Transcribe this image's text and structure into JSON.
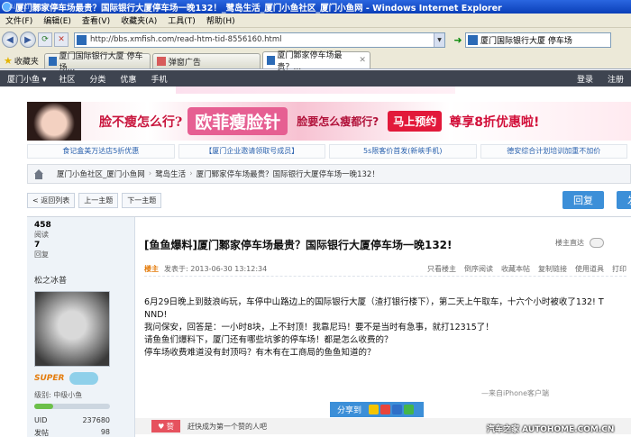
{
  "window": {
    "title": "厦门鄹家停车场最贵？国际银行大厦停车场一晚132！_鹭岛生活_厦门小鱼社区_厦门小鱼网 - Windows Internet Explorer",
    "watermark_overlay": "Ainkthutoe.com"
  },
  "menu": {
    "items": [
      "文件(F)",
      "编辑(E)",
      "查看(V)",
      "收藏夹(A)",
      "工具(T)",
      "帮助(H)"
    ]
  },
  "address": {
    "url": "http://bbs.xmfish.com/read-htm-tid-8556160.html",
    "search_value": "厦门国际银行大厦 停车场"
  },
  "favorites": {
    "label": "收藏夹",
    "tabs": [
      {
        "label": "厦门国际银行大厦 停车场..."
      },
      {
        "label": "弹窗广告"
      },
      {
        "label": "厦门鄹家停车场最贵？..."
      }
    ]
  },
  "sitenav": {
    "brand": "厦门小鱼 ▾",
    "items": [
      "社区",
      "分类",
      "优惠",
      "手机"
    ],
    "right": [
      "登录",
      "注册"
    ]
  },
  "ad": {
    "q1": "脸不瘦怎么行?",
    "brand": "欧菲瘦脸针",
    "q2": "脸要怎么瘦都行?",
    "button": "马上预约",
    "offer": "尊享8折优惠啦!"
  },
  "links": [
    "食记盒美万达店5折优惠",
    "【厦门企业邀请领取号成员】",
    "5s限客价首发(新峡手机)",
    "德安综合计划培训加重不加价"
  ],
  "breadcrumb": [
    "厦门小鱼社区_厦门小鱼网",
    "鹭岛生活",
    "厦门鄹家停车场最贵？国际银行大厦停车场一晚132！"
  ],
  "pager": {
    "back": "< 返回列表",
    "prev": "上一主题",
    "next": "下一主题",
    "reply": "回复",
    "post": "发帖"
  },
  "user": {
    "views": "458",
    "views_label": "阅读",
    "replies": "7",
    "replies_label": "回复",
    "name": "松之冰普",
    "super": "SUPER",
    "level": "级别: 中级小鱼",
    "level_progress": 0.25,
    "uid_label": "UID",
    "uid": "237680",
    "extra_label": "发帖",
    "extra": "98"
  },
  "post": {
    "title": "[鱼鱼爆料]厦门鄹家停车场最贵？国际银行大厦停车场一晚132!",
    "toggle_label": "楼主直达",
    "lz_badge": "楼主",
    "date": "发表于: 2013-06-30 13:12:34",
    "actions": [
      "只看楼主",
      "倒序阅读",
      "收藏本帖",
      "复制链接",
      "使用道具",
      "打印"
    ],
    "lines": [
      "6月29日晚上到鼓浪屿玩，车停中山路边上的国际银行大厦（渣打银行楼下），第二天上午取车，十六个小时被收了132! T",
      "NND!",
      "我问保安，回答是：一小时8块，上不封顶！我靠尼玛！要不是当时有急事，就打12315了！",
      "请鱼鱼们爆料下，厦门还有哪些坑爹的停车场！都是怎么收费的？",
      "停车场收费难道没有封顶吗？有木有在工商局的鱼鱼知道的？"
    ],
    "sign": "—来自iPhone客户端",
    "share_label": "分享到",
    "like_label": "赞",
    "like_text": "赶快成为第一个赞的人吧"
  },
  "footer_watermark": "汽车之家 AUTOHOME.COM.CN"
}
